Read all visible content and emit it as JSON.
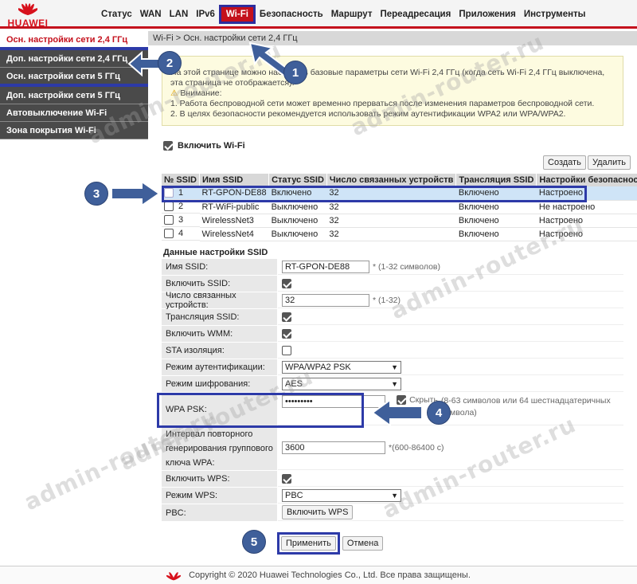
{
  "brand": {
    "name": "HUAWEI",
    "color": "#d7111c"
  },
  "nav": [
    "Статус",
    "WAN",
    "LAN",
    "IPv6",
    "Wi-Fi",
    "Безопасность",
    "Маршрут",
    "Переадресация",
    "Приложения",
    "Инструменты"
  ],
  "nav_active": "Wi-Fi",
  "sidebar": [
    "Осн. настройки сети 2,4 ГГц",
    "Доп. настройки сети 2,4 ГГц",
    "Осн. настройки сети 5 ГГц",
    "Доп. настройки сети 5 ГГц",
    "Автовыключение Wi-Fi",
    "Зона покрытия Wi-Fi"
  ],
  "breadcrumb": "Wi-Fi > Осн. настройки сети 2,4 ГГц",
  "notice": {
    "line1": "На этой странице можно настроить базовые параметры сети Wi-Fi 2,4 ГГц (когда сеть Wi-Fi 2,4 ГГц выключена, эта страница не отображается).",
    "attention": "Внимание:",
    "item1": "1. Работа беспроводной сети может временно прерваться после изменения параметров беспроводной сети.",
    "item2": "2. В целях безопасности рекомендуется использовать режим аутентификации WPA2 или WPA/WPA2."
  },
  "enable_wifi": {
    "label": "Включить Wi-Fi",
    "checked": true
  },
  "buttons": {
    "create": "Создать",
    "delete": "Удалить",
    "apply": "Применить",
    "cancel": "Отмена",
    "wps": "Включить WPS"
  },
  "ssid_table": {
    "headers": [
      "№ SSID",
      "Имя SSID",
      "Статус SSID",
      "Число связанных устройств",
      "Трансляция SSID",
      "Настройки безопасности"
    ],
    "rows": [
      {
        "num": "1",
        "name": "RT-GPON-DE88",
        "status": "Включено",
        "devices": "32",
        "broadcast": "Включено",
        "security": "Настроено"
      },
      {
        "num": "2",
        "name": "RT-WiFi-public",
        "status": "Выключено",
        "devices": "32",
        "broadcast": "Включено",
        "security": "Не настроено"
      },
      {
        "num": "3",
        "name": "WirelessNet3",
        "status": "Выключено",
        "devices": "32",
        "broadcast": "Включено",
        "security": "Настроено"
      },
      {
        "num": "4",
        "name": "WirelessNet4",
        "status": "Выключено",
        "devices": "32",
        "broadcast": "Включено",
        "security": "Настроено"
      }
    ]
  },
  "section_title": "Данные настройки SSID",
  "form": {
    "ssid_name": {
      "label": "Имя SSID:",
      "value": "RT-GPON-DE88",
      "hint": "* (1-32 символов)"
    },
    "enable_ssid": {
      "label": "Включить SSID:",
      "checked": true
    },
    "devices": {
      "label": "Число связанных устройств:",
      "value": "32",
      "hint": "* (1-32)"
    },
    "broadcast": {
      "label": "Трансляция SSID:",
      "checked": true
    },
    "wmm": {
      "label": "Включить WMM:",
      "checked": true
    },
    "sta": {
      "label": "STA изоляция:",
      "checked": false
    },
    "auth": {
      "label": "Режим аутентификации:",
      "value": "WPA/WPA2 PSK"
    },
    "enc": {
      "label": "Режим шифрования:",
      "value": "AES"
    },
    "psk": {
      "label": "WPA PSK:",
      "value": "•••••••••",
      "hide": "Скрыть",
      "hint": "(8-63 символов или 64 шестнадцатеричных символа)"
    },
    "rekey": {
      "label": "Интервал повторного генерирования группового ключа WPA:",
      "value": "3600",
      "hint": "*(600-86400 с)"
    },
    "wps_enable": {
      "label": "Включить WPS:",
      "checked": true
    },
    "wps_mode": {
      "label": "Режим WPS:",
      "value": "PBC"
    },
    "pbc": {
      "label": "PBC:"
    }
  },
  "footer": "Copyright © 2020 Huawei Technologies Co., Ltd. Все права защищены.",
  "watermark": "admin-router.ru",
  "annotations": [
    "1",
    "2",
    "3",
    "4",
    "5"
  ]
}
